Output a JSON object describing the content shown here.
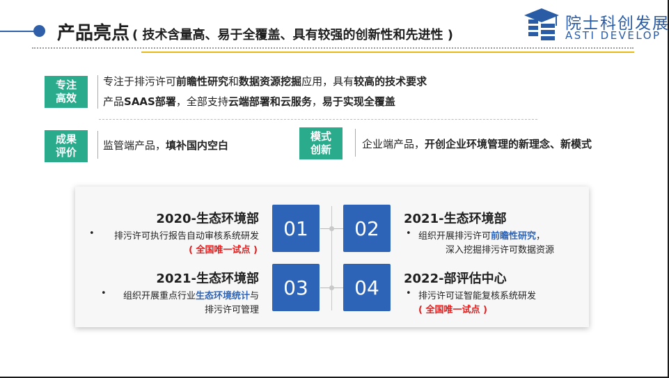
{
  "header": {
    "title": "产品亮点",
    "subtitle": "( 技术含量高、易于全覆盖、具有较强的创新性和先进性 )"
  },
  "logo": {
    "cn": "院士科创发展",
    "en": "ASTI DEVELOP",
    "icon": "graduation-cap-icon"
  },
  "highlights": [
    {
      "tag_l1": "专注",
      "tag_l2": "高效"
    },
    {
      "tag_l1": "成果",
      "tag_l2": "评价"
    },
    {
      "tag_l1": "模式",
      "tag_l2": "创新"
    }
  ],
  "row1": {
    "a1": "专注于排污许可",
    "b1": "前瞻性研究",
    "a2": "和",
    "b2": "数据资源挖掘",
    "a3": "应用，具有",
    "b3": "较高的技术要求"
  },
  "row2": {
    "a1": "产品",
    "b1": "SAAS部署",
    "a2": "，全部支持",
    "b2": "云端部署和云服务",
    "a3": "，",
    "b3": "易于实现全覆盖"
  },
  "row3": {
    "a1": "监管端产品，",
    "b1": "填补国内空白"
  },
  "row4": {
    "a1": "企业端产品，",
    "b1": "开创企业环境管理的新理念、新模式"
  },
  "timeline": [
    {
      "num": "01",
      "title": "2020-生态环境部",
      "bullet": "•",
      "l1": "排污许可执行报告自动审核系统研发",
      "l2": "( 全国唯一试点 )"
    },
    {
      "num": "02",
      "title": "2021-生态环境部",
      "bullet": "•",
      "l1a": "组织开展排污许可",
      "l1b": "前瞻性研究",
      "l1c": "，",
      "l2": "深入挖掘排污许可数据资源"
    },
    {
      "num": "03",
      "title": "2021-生态环境部",
      "bullet": "•",
      "l1a": "组织开展重点行业",
      "l1b": "生态环境统计",
      "l1c": "与",
      "l2": "排污许可管理"
    },
    {
      "num": "04",
      "title": "2022-部评估中心",
      "bullet": "•",
      "l1": "排污许可证智能复核系统研发",
      "l2": "( 全国唯一试点 )"
    }
  ],
  "colors": {
    "accent_blue": "#2d64b8",
    "tag_green": "#2aab8b",
    "gold": "#e8b816",
    "red": "#e11d1d"
  }
}
